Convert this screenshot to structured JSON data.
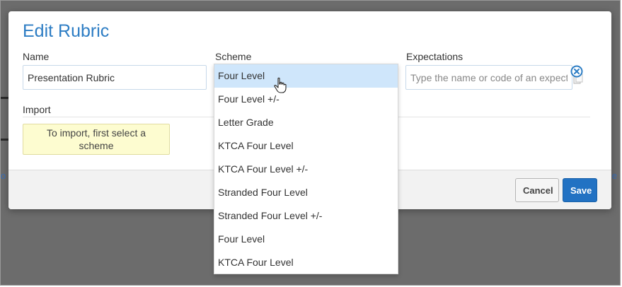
{
  "modal": {
    "title": "Edit Rubric",
    "name_label": "Name",
    "name_value": "Presentation Rubric",
    "scheme_label": "Scheme",
    "expectations_label": "Expectations",
    "expectations_placeholder": "Type the name or code of an expectation",
    "import_label": "Import",
    "import_note": "To import, first select a scheme"
  },
  "dropdown": {
    "selected_index": 0,
    "items": [
      "Four Level",
      "Four Level +/-",
      "Letter Grade",
      "KTCA Four Level",
      "KTCA Four Level +/-",
      "Stranded Four Level",
      "Stranded Four Level +/-",
      "Four Level",
      "KTCA Four Level"
    ]
  },
  "footer": {
    "cancel_label": "Cancel",
    "save_label": "Save"
  },
  "background": {
    "left_fragment": "o",
    "right_fragment": "e"
  },
  "colors": {
    "accent": "#2d7dc4",
    "save_button": "#2272c3",
    "selected_option": "#cfe6fb",
    "import_note_bg": "#fdfcd0"
  },
  "icons": {
    "clear": "clear-circle-icon",
    "copy": "copy-icon",
    "cursor": "hand-pointer-icon"
  }
}
